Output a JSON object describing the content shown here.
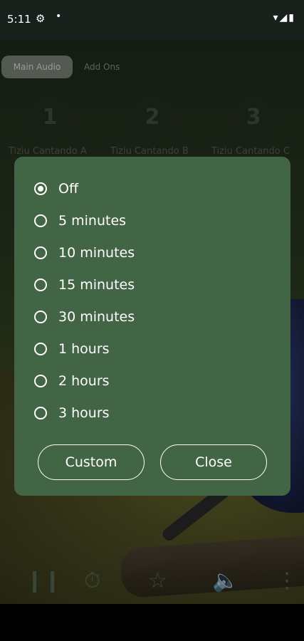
{
  "status_bar": {
    "time": "5:11",
    "settings_icon": "gear-icon",
    "dot": "•",
    "system_icons": "▾◢▮"
  },
  "tabs": [
    {
      "label": "Main Audio"
    },
    {
      "label": "Add Ons"
    }
  ],
  "cards": [
    {
      "number": "1",
      "label": "Tiziu Cantando A"
    },
    {
      "number": "2",
      "label": "Tiziu Cantando B"
    },
    {
      "number": "3",
      "label": "Tiziu Cantando C"
    }
  ],
  "dialog": {
    "selected": "Off",
    "options": [
      {
        "label": "Off"
      },
      {
        "label": "5 minutes"
      },
      {
        "label": "10 minutes"
      },
      {
        "label": "15 minutes"
      },
      {
        "label": "30 minutes"
      },
      {
        "label": "1 hours"
      },
      {
        "label": "2 hours"
      },
      {
        "label": "3 hours"
      }
    ],
    "custom_label": "Custom",
    "close_label": "Close"
  },
  "toolbar": {
    "icons": [
      "pause-icon",
      "timer-icon",
      "star-icon",
      "volume-icon",
      "more-icon"
    ]
  },
  "colors": {
    "dialog_bg": "#426545",
    "accent": "#ffffff"
  }
}
